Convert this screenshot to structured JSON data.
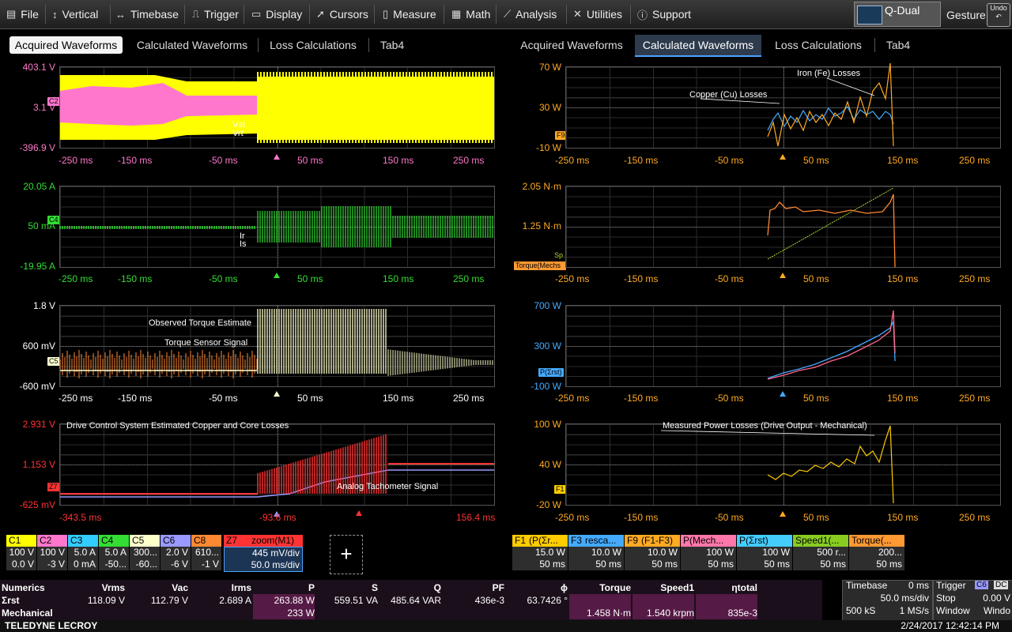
{
  "menu": {
    "items": [
      {
        "label": "File",
        "icon": "file-icon"
      },
      {
        "label": "Vertical",
        "icon": "vertical-arrows-icon"
      },
      {
        "label": "Timebase",
        "icon": "horizontal-arrows-icon"
      },
      {
        "label": "Trigger",
        "icon": "trigger-icon"
      },
      {
        "label": "Display",
        "icon": "display-icon"
      },
      {
        "label": "Cursors",
        "icon": "cursor-icon"
      },
      {
        "label": "Measure",
        "icon": "measure-icon"
      },
      {
        "label": "Math",
        "icon": "calculator-icon"
      },
      {
        "label": "Analysis",
        "icon": "chart-icon"
      },
      {
        "label": "Utilities",
        "icon": "wrench-icon"
      },
      {
        "label": "Support",
        "icon": "info-icon"
      }
    ],
    "display_mode": "Q-Dual",
    "gesture_label": "Gesture",
    "undo_label": "Undo"
  },
  "tabs_left": [
    "Acquired Waveforms",
    "Calculated Waveforms",
    "Loss Calculations",
    "Tab4"
  ],
  "tabs_right": [
    "Acquired Waveforms",
    "Calculated Waveforms",
    "Loss Calculations",
    "Tab4"
  ],
  "x_ticks": [
    "-250 ms",
    "-150 ms",
    "-50 ms",
    "50 ms",
    "150 ms",
    "250 ms"
  ],
  "x_ticks_zoom": [
    "-343.5 ms",
    "-93.6 ms",
    "156.4 ms"
  ],
  "left_grids": [
    {
      "y_top": "403.1 V",
      "y_mid": "3.1 V",
      "y_bot": "-396.9 V",
      "label_color": "#ff77cc",
      "badge": "C2",
      "badge_color": "#ff77cc",
      "annotations": [
        "Vst",
        "Vrt"
      ]
    },
    {
      "y_top": "20.05 A",
      "y_mid": "50 mA",
      "y_bot": "-19.95 A",
      "label_color": "#33dd33",
      "badge": "C4",
      "badge_color": "#33dd33",
      "annotations": [
        "Ir",
        "Is"
      ]
    },
    {
      "y_top": "1.8 V",
      "y_mid": "600 mV",
      "y_bot": "-600 mV",
      "label_color": "#ffffff",
      "badge": "C5",
      "badge_color": "#ffffcc",
      "annotations": [
        "Observed Torque Estimate",
        "Torque Sensor Signal"
      ]
    },
    {
      "y_top": "2.931 V",
      "y_mid": "1.153 V",
      "y_bot": "-625 mV",
      "label_color": "#ff3333",
      "badge": "Z7",
      "badge_color": "#ff3333",
      "annotations": [
        "Drive Control System Estimated Copper and Core Losses",
        "Analog Tachometer Signal"
      ]
    }
  ],
  "right_grids": [
    {
      "y_top": "70 W",
      "y_mid": "30 W",
      "y_bot": "-10 W",
      "label_color": "#ffaa22",
      "badge": "F9",
      "badge_color": "#ffaa22",
      "annotations": [
        "Iron (Fe) Losses",
        "Copper (Cu) Losses"
      ]
    },
    {
      "y_top": "2.05 N·m",
      "y_mid": "1.25 N·m",
      "y_bot": "",
      "label_color": "#ffaa22",
      "badge": "Torque(Mechs",
      "badge_color": "#ff9933",
      "annotations": [
        "Sp."
      ]
    },
    {
      "y_top": "700 W",
      "y_mid": "300 W",
      "y_bot": "-100 W",
      "label_color": "#44aaff",
      "badge": "P(Σrst)",
      "badge_color": "#44aaff",
      "annotations": []
    },
    {
      "y_top": "100 W",
      "y_mid": "40 W",
      "y_bot": "-20 W",
      "label_color": "#ffaa22",
      "badge": "F1",
      "badge_color": "#ffcc00",
      "annotations": [
        "Measured Power Losses (Drive Output - Mechanical)"
      ]
    }
  ],
  "channels_left": [
    {
      "name": "C1",
      "v1": "100 V",
      "v2": "0.0 V",
      "color": "#ffff00"
    },
    {
      "name": "C2",
      "v1": "100 V",
      "v2": "-3 V",
      "color": "#ff77cc"
    },
    {
      "name": "C3",
      "v1": "5.0 A",
      "v2": "0 mA",
      "color": "#33ccff"
    },
    {
      "name": "C4",
      "v1": "5.0 A",
      "v2": "-50...",
      "color": "#33dd33"
    },
    {
      "name": "C5",
      "v1": "300...",
      "v2": "-60...",
      "color": "#ffffcc"
    },
    {
      "name": "C6",
      "v1": "2.0 V",
      "v2": "-6 V",
      "color": "#9999ff"
    },
    {
      "name": "C8",
      "v1": "610...",
      "v2": "-1 V",
      "color": "#ff8833"
    },
    {
      "name": "Z7",
      "title": "zoom(M1)",
      "v1": "445 mV/div",
      "v2": "50.0 ms/div",
      "color": "#ff3333"
    }
  ],
  "channels_right": [
    {
      "name": "F1",
      "title": "(P(Σr...",
      "v1": "15.0 W",
      "v2": "50 ms",
      "color": "#ffcc00"
    },
    {
      "name": "F3",
      "title": "resca...",
      "v1": "10.0 W",
      "v2": "50 ms",
      "color": "#44aaff"
    },
    {
      "name": "F9",
      "title": "(F1-F3)",
      "v1": "10.0 W",
      "v2": "50 ms",
      "color": "#ffaa22"
    },
    {
      "name": "P(Mech...",
      "title": "",
      "v1": "100 W",
      "v2": "50 ms",
      "color": "#ff77aa"
    },
    {
      "name": "P(Σrst)",
      "title": "",
      "v1": "100 W",
      "v2": "50 ms",
      "color": "#44ccff"
    },
    {
      "name": "Speed1(...",
      "title": "",
      "v1": "500 r...",
      "v2": "50 ms",
      "color": "#88cc22"
    },
    {
      "name": "Torque(...",
      "title": "",
      "v1": "200...",
      "v2": "50 ms",
      "color": "#ff9933"
    }
  ],
  "numerics": {
    "headers": [
      "Numerics",
      "Vrms",
      "Vac",
      "Irms",
      "P",
      "S",
      "Q",
      "PF",
      "ϕ",
      "Torque",
      "Speed1",
      "ηtotal"
    ],
    "row1": [
      "Σrst",
      "118.09 V",
      "112.79 V",
      "2.689 A",
      "263.88 W",
      "559.51 VA",
      "485.64 VAR",
      "436e-3",
      "63.7426 °",
      "",
      "",
      ""
    ],
    "row2": [
      "Mechanical",
      "",
      "",
      "",
      "233 W",
      "",
      "",
      "",
      "",
      "1.458 N·m",
      "1.540 krpm",
      "835e-3"
    ]
  },
  "timebase": {
    "title": "Timebase",
    "offset": "0 ms",
    "per_div": "50.0 ms/div",
    "sample": "500 kS",
    "rate": "1 MS/s"
  },
  "trigger": {
    "title": "Trigger",
    "badge1": "C6",
    "badge2": "DC",
    "mode": "Stop",
    "level": "0.00 V",
    "type1": "Window",
    "type2": "Windo"
  },
  "footer": {
    "brand": "TELEDYNE LECROY",
    "datetime": "2/24/2017 12:42:14 PM"
  }
}
